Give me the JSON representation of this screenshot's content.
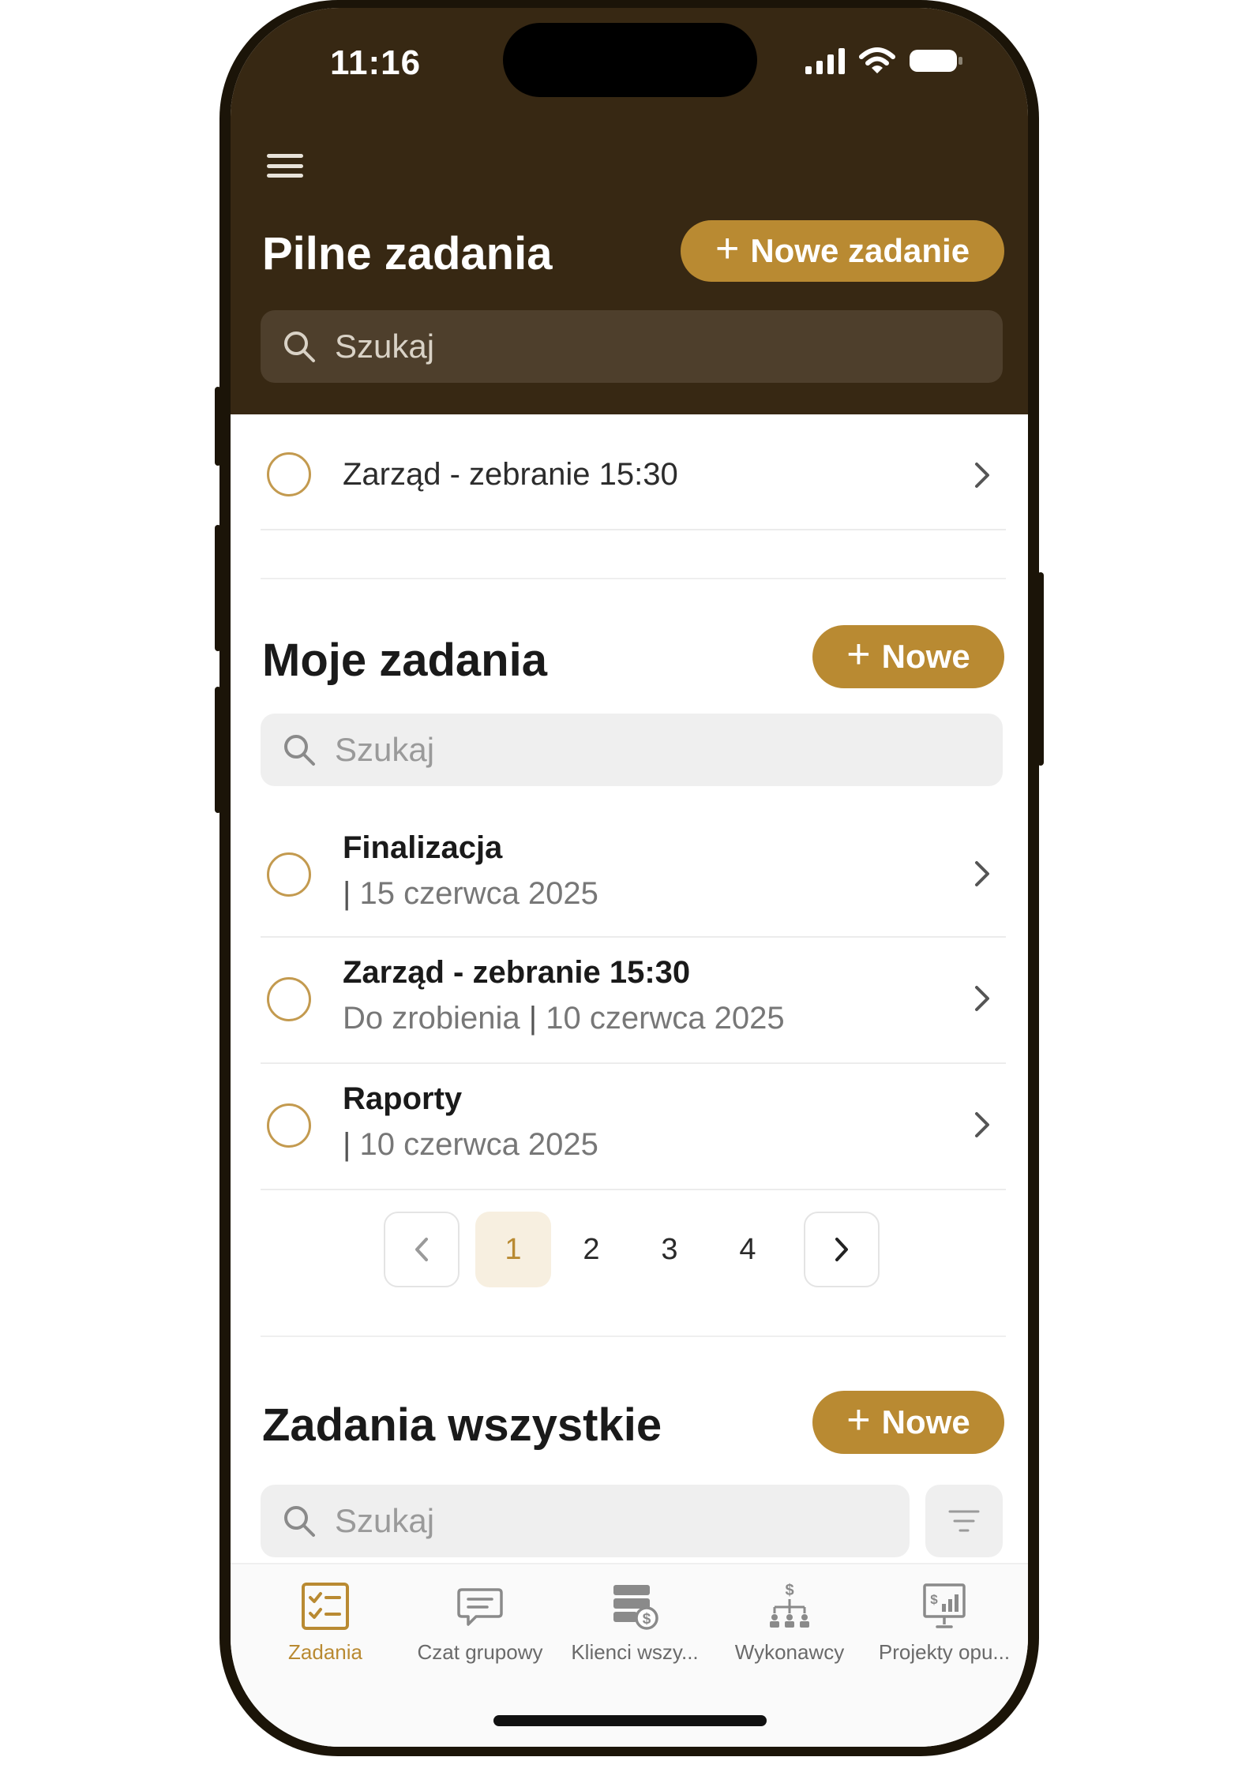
{
  "status_bar": {
    "time": "11:16"
  },
  "urgent": {
    "title": "Pilne zadania",
    "new_button_label": "Nowe zadanie",
    "search_placeholder": "Szukaj",
    "items": [
      {
        "label": "Zarząd - zebranie 15:30"
      }
    ]
  },
  "my_tasks": {
    "title": "Moje zadania",
    "new_button_label": "Nowe",
    "search_placeholder": "Szukaj",
    "items": [
      {
        "title": "Finalizacja",
        "status": "",
        "separator": "|",
        "date": "15 czerwca 2025"
      },
      {
        "title": "Zarząd - zebranie 15:30",
        "status": "Do zrobienia",
        "separator": "|",
        "date": "10 czerwca 2025"
      },
      {
        "title": "Raporty",
        "status": "",
        "separator": "|",
        "date": "10 czerwca 2025"
      }
    ],
    "pagination": {
      "current_page": 1,
      "pages": [
        "1",
        "2",
        "3",
        "4"
      ]
    }
  },
  "all_tasks": {
    "title": "Zadania wszystkie",
    "new_button_label": "Nowe",
    "search_placeholder": "Szukaj"
  },
  "tab_bar": {
    "tabs": [
      {
        "label": "Zadania",
        "icon": "tasks-checklist-icon",
        "active": true
      },
      {
        "label": "Czat grupowy",
        "icon": "chat-bubble-icon",
        "active": false
      },
      {
        "label": "Klienci wszy...",
        "icon": "clients-money-icon",
        "active": false
      },
      {
        "label": "Wykonawcy",
        "icon": "org-chart-money-icon",
        "active": false
      },
      {
        "label": "Projekty opu...",
        "icon": "presentation-chart-icon",
        "active": false
      }
    ]
  },
  "colors": {
    "header_bg": "#372813",
    "accent": "#b98a32",
    "header_search_bg": "#4e3f2c",
    "light_search_bg": "#efefef",
    "active_page_bg": "#f7efe0"
  }
}
